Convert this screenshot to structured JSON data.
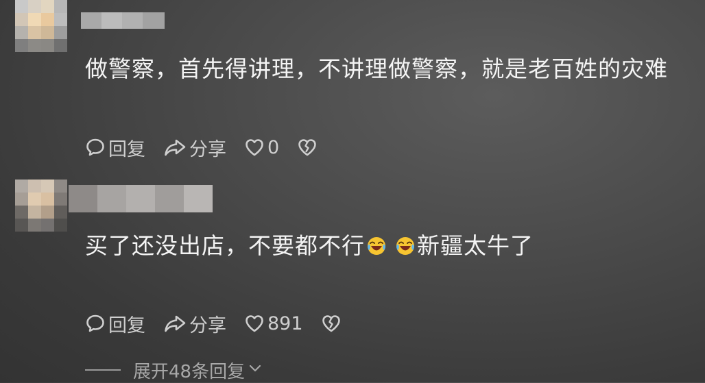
{
  "comments": [
    {
      "text": "做警察，首先得讲理，不讲理做警察，就是老百姓的灾难",
      "actions": {
        "reply_label": "回复",
        "share_label": "分享",
        "like_count": "0"
      }
    },
    {
      "text": "买了还没出店，不要都不行",
      "text_after": "新疆太牛了",
      "actions": {
        "reply_label": "回复",
        "share_label": "分享",
        "like_count": "891"
      }
    }
  ],
  "expand_replies_label": "展开48条回复",
  "icons": {
    "reply": "comment-bubble-icon",
    "share": "share-arrow-icon",
    "like": "heart-icon",
    "dislike": "broken-heart-icon",
    "laugh": "laughing-crying-emoji",
    "expand": "chevron-down-icon"
  },
  "colors": {
    "background": "#4a4a4a",
    "text": "#f4f4f4",
    "action_text": "#cfcfcf",
    "expand_text": "#a8a8a8"
  }
}
